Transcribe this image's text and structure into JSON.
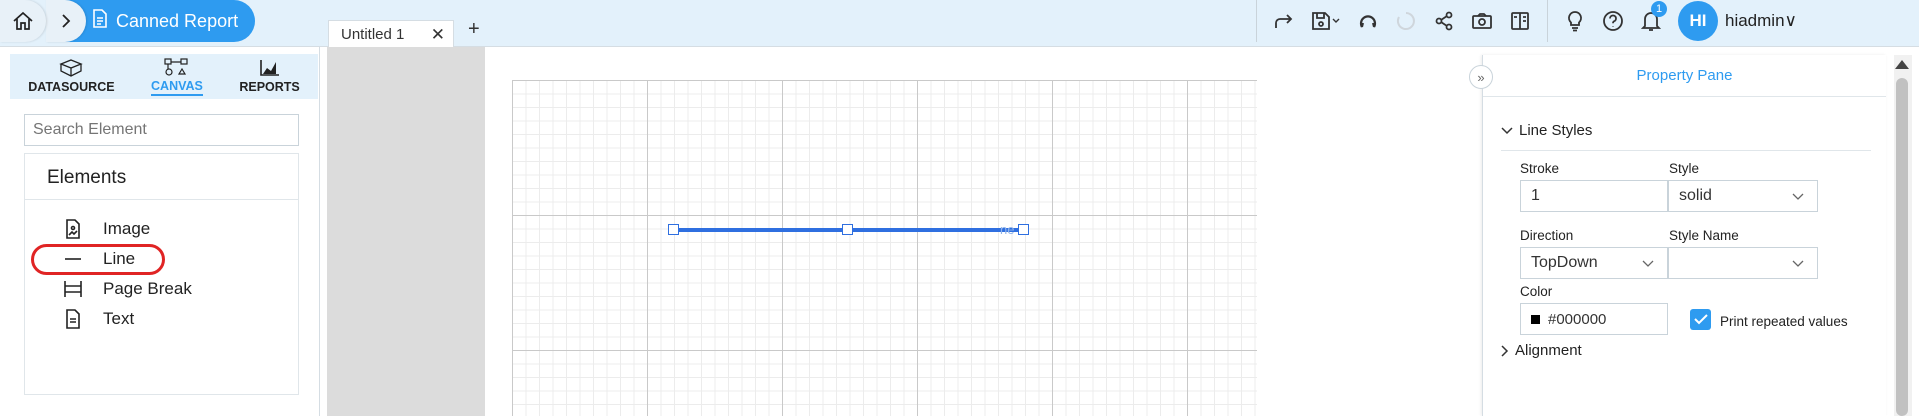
{
  "topbar": {
    "report_label": "Canned Report",
    "tab_label": "Untitled 1",
    "tab_close": "✕",
    "tab_add": "+",
    "notification_count": "1",
    "avatar_initials": "HI",
    "username": "hiadmin∨"
  },
  "leftpanel": {
    "tabs": [
      {
        "label": "DATASOURCE",
        "icon": "database-icon",
        "active": false
      },
      {
        "label": "CANVAS",
        "icon": "canvas-icon",
        "active": true
      },
      {
        "label": "REPORTS",
        "icon": "reports-icon",
        "active": false
      }
    ],
    "search_placeholder": "Search Element",
    "elements_title": "Elements",
    "elements": [
      {
        "label": "Image",
        "icon": "image-file-icon"
      },
      {
        "label": "Line",
        "icon": "line-icon",
        "highlighted": true
      },
      {
        "label": "Page Break",
        "icon": "page-break-icon"
      },
      {
        "label": "Text",
        "icon": "text-file-icon"
      }
    ]
  },
  "canvas": {
    "line_ghost_text": "ne"
  },
  "property_pane": {
    "title": "Property Pane",
    "collapse_glyph": "»",
    "line_styles_title": "Line Styles",
    "stroke_label": "Stroke",
    "stroke_value": "1",
    "style_label": "Style",
    "style_value": "solid",
    "direction_label": "Direction",
    "direction_value": "TopDown",
    "style_name_label": "Style Name",
    "style_name_value": "",
    "color_label": "Color",
    "color_value": "#000000",
    "print_repeated_label": "Print repeated values",
    "print_repeated_checked": true,
    "alignment_title": "Alignment"
  },
  "colors": {
    "accent": "#2e9bf0",
    "topbar_bg": "#e3f1fb",
    "line_element": "#2f6fe0",
    "highlight_ring": "#e02424"
  }
}
